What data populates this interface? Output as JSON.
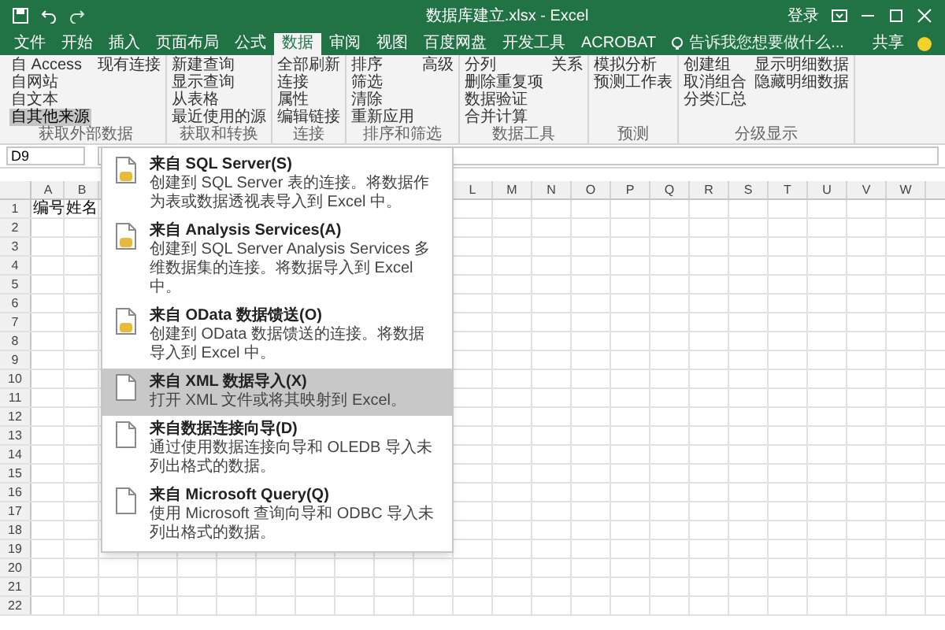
{
  "window": {
    "title": "数据库建立.xlsx - Excel",
    "account": "登录"
  },
  "tabs": [
    {
      "label": "文件",
      "selected": false
    },
    {
      "label": "开始",
      "selected": false
    },
    {
      "label": "插入",
      "selected": false
    },
    {
      "label": "页面布局",
      "selected": false
    },
    {
      "label": "公式",
      "selected": false
    },
    {
      "label": "数据",
      "selected": true
    },
    {
      "label": "审阅",
      "selected": false
    },
    {
      "label": "视图",
      "selected": false
    },
    {
      "label": "百度网盘",
      "selected": false
    },
    {
      "label": "开发工具",
      "selected": false
    },
    {
      "label": "ACROBAT",
      "selected": false
    }
  ],
  "tell_me": {
    "placeholder": "告诉我您想要做什么..."
  },
  "share": "共享",
  "ribbon": {
    "groups": [
      {
        "label": "获取外部数据",
        "columns": [
          [
            {
              "label": "自 Access",
              "selected": false
            },
            {
              "label": "自网站",
              "selected": false
            },
            {
              "label": "自文本",
              "selected": false
            },
            {
              "label": "自其他来源",
              "selected": true
            }
          ],
          [
            {
              "label": "现有连接",
              "selected": false
            }
          ]
        ]
      },
      {
        "label": "获取和转换",
        "columns": [
          [
            {
              "label": "新建查询",
              "selected": false
            },
            {
              "label": "显示查询",
              "selected": false
            },
            {
              "label": "从表格",
              "selected": false
            },
            {
              "label": "最近使用的源",
              "selected": false
            }
          ]
        ]
      },
      {
        "label": "连接",
        "columns": [
          [
            {
              "label": "全部刷新",
              "selected": false
            },
            {
              "label": "连接",
              "selected": false
            },
            {
              "label": "属性",
              "selected": false
            },
            {
              "label": "编辑链接",
              "selected": false
            }
          ]
        ]
      },
      {
        "label": "排序和筛选",
        "columns": [
          [
            {
              "label": "排序",
              "selected": false
            },
            {
              "label": "筛选",
              "selected": false
            },
            {
              "label": "清除",
              "selected": false
            },
            {
              "label": "重新应用",
              "selected": false
            }
          ],
          [
            {
              "label": "高级",
              "selected": false
            }
          ]
        ]
      },
      {
        "label": "数据工具",
        "columns": [
          [
            {
              "label": "分列",
              "selected": false
            },
            {
              "label": "删除重复项",
              "selected": false
            },
            {
              "label": "数据验证",
              "selected": false
            },
            {
              "label": "合并计算",
              "selected": false
            }
          ],
          [
            {
              "label": "关系",
              "selected": false
            }
          ]
        ]
      },
      {
        "label": "预测",
        "columns": [
          [
            {
              "label": "模拟分析",
              "selected": false
            },
            {
              "label": "预测工作表",
              "selected": false
            }
          ]
        ]
      },
      {
        "label": "分级显示",
        "columns": [
          [
            {
              "label": "创建组",
              "selected": false
            },
            {
              "label": "取消组合",
              "selected": false
            },
            {
              "label": "分类汇总",
              "selected": false
            }
          ],
          [
            {
              "label": "显示明细数据",
              "selected": false
            },
            {
              "label": "隐藏明细数据",
              "selected": false
            }
          ]
        ]
      }
    ]
  },
  "name_box": "D9",
  "columns": [
    "A",
    "B",
    "L",
    "M",
    "N",
    "O",
    "P",
    "Q",
    "R",
    "S",
    "T",
    "U",
    "V",
    "W"
  ],
  "rows": [
    {
      "number": "1",
      "cells": [
        "编号",
        "姓名"
      ]
    },
    {
      "number": "2"
    },
    {
      "number": "3"
    },
    {
      "number": "4"
    },
    {
      "number": "5"
    },
    {
      "number": "6"
    },
    {
      "number": "7"
    },
    {
      "number": "8"
    },
    {
      "number": "9"
    },
    {
      "number": "10"
    },
    {
      "number": "11"
    },
    {
      "number": "12"
    },
    {
      "number": "13"
    },
    {
      "number": "14"
    },
    {
      "number": "15"
    },
    {
      "number": "16"
    },
    {
      "number": "17"
    },
    {
      "number": "18"
    },
    {
      "number": "19"
    },
    {
      "number": "20"
    },
    {
      "number": "21"
    },
    {
      "number": "22"
    }
  ],
  "menu": {
    "items": [
      {
        "title": "来自 SQL Server(S)",
        "description": "创建到 SQL Server 表的连接。将数据作为表或数据透视表导入到 Excel 中。",
        "selected": false
      },
      {
        "title": "来自 Analysis Services(A)",
        "description": "创建到 SQL Server Analysis Services 多维数据集的连接。将数据导入到 Excel 中。",
        "selected": false
      },
      {
        "title": "来自 OData 数据馈送(O)",
        "description": "创建到 OData 数据馈送的连接。将数据导入到 Excel 中。",
        "selected": false
      },
      {
        "title": "来自 XML 数据导入(X)",
        "description": "打开 XML 文件或将其映射到 Excel。",
        "selected": true
      },
      {
        "title": "来自数据连接向导(D)",
        "description": "通过使用数据连接向导和 OLEDB 导入未列出格式的数据。",
        "selected": false
      },
      {
        "title": "来自 Microsoft Query(Q)",
        "description": "使用 Microsoft 查询向导和 ODBC 导入未列出格式的数据。",
        "selected": false
      }
    ]
  }
}
